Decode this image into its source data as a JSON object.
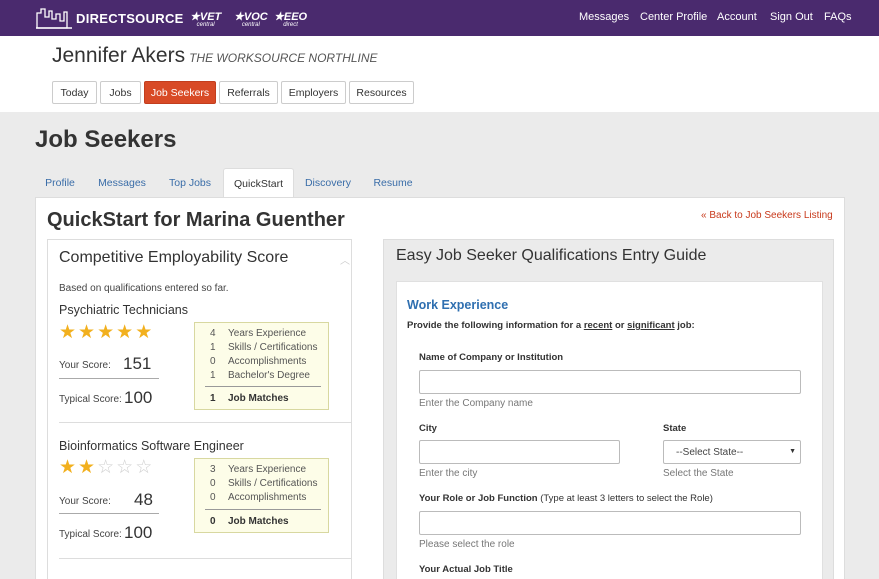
{
  "brand": {
    "logo_text": "DIRECTSOURCE",
    "partners": [
      {
        "label": "VET",
        "sub": "central"
      },
      {
        "label": "VOC",
        "sub": "central"
      },
      {
        "label": "EEO",
        "sub": "direct"
      }
    ]
  },
  "topnav": [
    "Messages",
    "Center Profile",
    "Account",
    "Sign Out",
    "FAQs"
  ],
  "header": {
    "user_name": "Jennifer Akers",
    "org_name": "THE WORKSOURCE NORTHLINE",
    "tabs": [
      "Today",
      "Jobs",
      "Job Seekers",
      "Referrals",
      "Employers",
      "Resources"
    ],
    "active_tab": "Job Seekers"
  },
  "page_title": "Job Seekers",
  "subtabs": [
    "Profile",
    "Messages",
    "Top Jobs",
    "QuickStart",
    "Discovery",
    "Resume"
  ],
  "active_subtab": "QuickStart",
  "quickstart": {
    "title": "QuickStart for Marina Guenther",
    "back_link": "« Back to Job Seekers Listing"
  },
  "ces": {
    "title": "Competitive Employability Score",
    "subtitle": "Based on qualifications entered so far.",
    "your_score_label": "Your Score:",
    "typical_score_label": "Typical Score:",
    "jobs": [
      {
        "title": "Psychiatric Technicians",
        "stars": 5,
        "your_score": "151",
        "typical_score": "100",
        "breakdown": [
          {
            "n": "4",
            "label": "Years Experience"
          },
          {
            "n": "1",
            "label": "Skills / Certifications"
          },
          {
            "n": "0",
            "label": "Accomplishments"
          },
          {
            "n": "1",
            "label": "Bachelor's Degree"
          }
        ],
        "total": {
          "n": "1",
          "label": "Job Matches"
        }
      },
      {
        "title": "Bioinformatics Software Engineer",
        "stars": 2,
        "your_score": "48",
        "typical_score": "100",
        "breakdown": [
          {
            "n": "3",
            "label": "Years Experience"
          },
          {
            "n": "0",
            "label": "Skills / Certifications"
          },
          {
            "n": "0",
            "label": "Accomplishments"
          }
        ],
        "total": {
          "n": "0",
          "label": "Job Matches"
        }
      }
    ]
  },
  "guide": {
    "title": "Easy Job Seeker Qualifications Entry Guide",
    "section_title": "Work Experience",
    "section_desc_pre": "Provide the following information for a ",
    "section_desc_recent": "recent",
    "section_desc_or": " or ",
    "section_desc_significant": "significant",
    "section_desc_post": " job:",
    "company_label": "Name of Company or Institution",
    "company_value": "",
    "company_help": "Enter the Company name",
    "city_label": "City",
    "city_value": "",
    "city_help": "Enter the city",
    "state_label": "State",
    "state_value": "--Select State--",
    "state_help": "Select the State",
    "role_label": "Your Role or Job Function",
    "role_hint": "(Type at least 3 letters to select the Role)",
    "role_value": "",
    "role_help": "Please select the role",
    "actual_title_label": "Your Actual Job Title"
  }
}
